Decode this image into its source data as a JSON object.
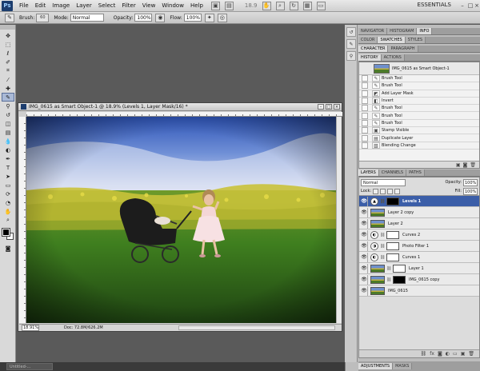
{
  "app": {
    "logo_text": "Ps",
    "menu": [
      "File",
      "Edit",
      "Image",
      "Layer",
      "Select",
      "Filter",
      "View",
      "Window",
      "Help"
    ],
    "zoom_readout": "18.9",
    "workspace": "ESSENTIALS"
  },
  "options": {
    "brush_label": "Brush:",
    "brush_size": "60",
    "mode_label": "Mode:",
    "mode_value": "Normal",
    "opacity_label": "Opacity:",
    "opacity_value": "100%",
    "flow_label": "Flow:",
    "flow_value": "100%"
  },
  "document": {
    "title": "IMG_0615 as Smart Object-1 @ 18.9% (Levels 1, Layer Mask/16) *",
    "zoom": "18.91%",
    "doc_size": "Doc: 72.8M/626.2M"
  },
  "taskbar": {
    "doc_label": "Untitled-..."
  },
  "panel_tabs": {
    "row1": [
      "Navigator",
      "Histogram",
      "Info"
    ],
    "row2": [
      "Color",
      "Swatches",
      "Styles"
    ],
    "row3": [
      "Character",
      "Paragraph"
    ],
    "row4": [
      "History",
      "Actions"
    ],
    "layers_tabs": [
      "Layers",
      "Channels",
      "Paths"
    ],
    "bottom_tabs": [
      "Adjustments",
      "Masks"
    ]
  },
  "history": {
    "snapshot": "IMG_0615 as Smart Object-1",
    "items": [
      "Brush Tool",
      "Brush Tool",
      "Add Layer Mask",
      "Invert",
      "Brush Tool",
      "Brush Tool",
      "Brush Tool",
      "Stamp Visible",
      "Duplicate Layer",
      "Blending Change"
    ]
  },
  "layers": {
    "blend_mode": "Normal",
    "opacity_label": "Opacity:",
    "opacity_value": "100%",
    "lock_label": "Lock:",
    "fill_label": "Fill:",
    "fill_value": "100%",
    "items": [
      {
        "name": "Levels 1",
        "kind": "adjustment",
        "selected": true,
        "mask": "black"
      },
      {
        "name": "Layer 2 copy",
        "kind": "pixel"
      },
      {
        "name": "Layer 2",
        "kind": "pixel"
      },
      {
        "name": "Curves 2",
        "kind": "adjustment",
        "mask": "white"
      },
      {
        "name": "Photo Filter 1",
        "kind": "adjustment",
        "mask": "white"
      },
      {
        "name": "Curves 1",
        "kind": "adjustment",
        "mask": "white"
      },
      {
        "name": "Layer 1",
        "kind": "pixel",
        "mask": "white"
      },
      {
        "name": "IMG_0615 copy",
        "kind": "smart",
        "mask": "black"
      },
      {
        "name": "IMG_0615",
        "kind": "smart"
      }
    ]
  }
}
